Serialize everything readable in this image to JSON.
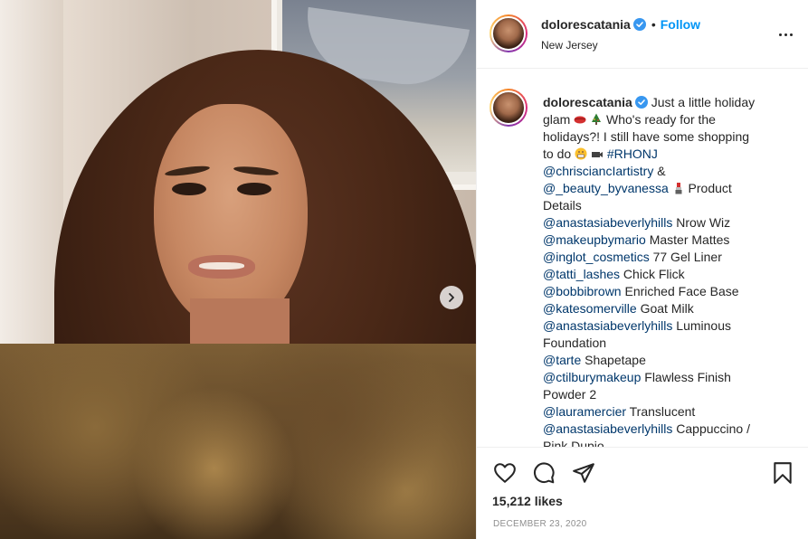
{
  "post": {
    "username": "dolorescatania",
    "follow_label": "Follow",
    "separator": "•",
    "location": "New Jersey",
    "verified": true
  },
  "caption": {
    "username": "dolorescatania",
    "line1": " Just a little holiday",
    "line2a": "glam ",
    "line2b": " Who's ready for the",
    "line3": "holidays?! I still have some shopping",
    "line4a": "to do ",
    "hashtag": "#RHONJ",
    "mention1": "@chrisciancIartistry",
    "amp": " &",
    "mention2": "@_beauty_byvanessa",
    "line7b": " Product",
    "line8": "Details",
    "items": [
      {
        "handle": "@anastasiabeverlyhills",
        "product": " Nrow Wiz"
      },
      {
        "handle": "@makeupbymario",
        "product": " Master Mattes"
      },
      {
        "handle": "@inglot_cosmetics",
        "product": " 77 Gel Liner"
      },
      {
        "handle": "@tatti_lashes",
        "product": " Chick Flick"
      },
      {
        "handle": "@bobbibrown",
        "product": " Enriched Face Base"
      },
      {
        "handle": "@katesomerville",
        "product": " Goat Milk"
      },
      {
        "handle": "@anastasiabeverlyhills",
        "product": " Luminous"
      }
    ],
    "foundation": "Foundation",
    "tarte_handle": "@tarte",
    "tarte_product": " Shapetape",
    "ctil_handle": "@ctilburymakeup",
    "ctil_product": " Flawless Finish",
    "powder": "Powder 2",
    "laura_handle": "@lauramercier",
    "laura_product": " Translucent",
    "abh_handle": "@anastasiabeverlyhills",
    "abh_product": " Cappuccino /",
    "cut_line": "Pink Dupio..."
  },
  "stats": {
    "likes": "15,212 likes",
    "date": "DECEMBER 23, 2020"
  },
  "colors": {
    "accent": "#0095f6",
    "mention": "#00376b",
    "text": "#262626",
    "muted": "#8e8e8e"
  },
  "icons": [
    "chevron-right-icon",
    "verified-icon",
    "more-icon",
    "heart-icon",
    "comment-icon",
    "share-icon",
    "bookmark-icon",
    "lips-emoji",
    "tree-emoji",
    "grimace-emoji",
    "camera-emoji",
    "lipstick-emoji"
  ]
}
